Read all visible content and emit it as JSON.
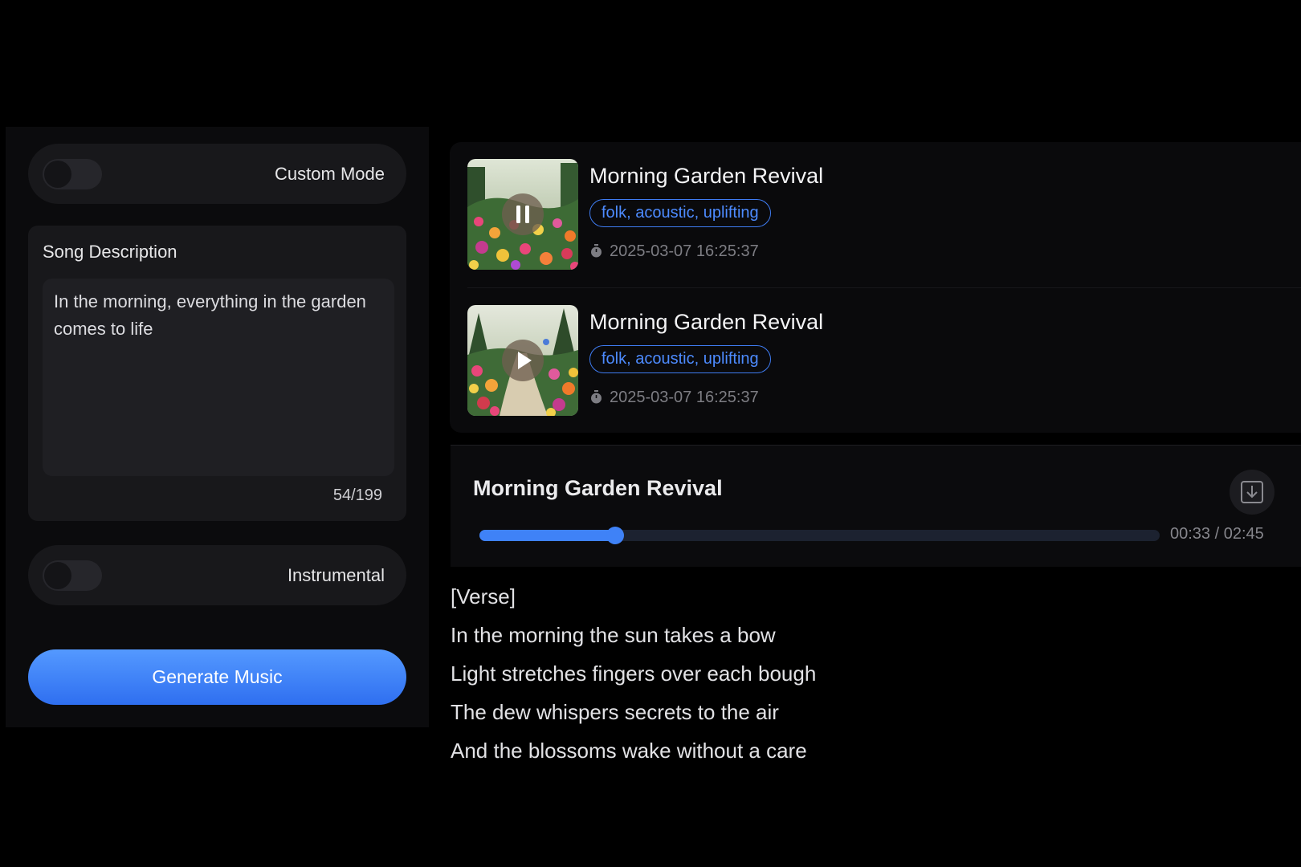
{
  "left_panel": {
    "custom_mode_label": "Custom Mode",
    "song_description": {
      "title": "Song Description",
      "value": "In the morning, everything in the garden comes to life",
      "char_count": "54/199"
    },
    "instrumental_label": "Instrumental",
    "generate_label": "Generate Music"
  },
  "songs": [
    {
      "title": "Morning Garden Revival",
      "tags": "folk, acoustic, uplifting",
      "timestamp": "2025-03-07 16:25:37",
      "state": "playing"
    },
    {
      "title": "Morning Garden Revival",
      "tags": "folk, acoustic, uplifting",
      "timestamp": "2025-03-07 16:25:37",
      "state": "paused"
    }
  ],
  "player": {
    "title": "Morning Garden Revival",
    "current_time": "00:33",
    "separator": " / ",
    "total_time": "02:45",
    "progress_fraction": 0.2,
    "download_icon": "download-icon"
  },
  "lyrics": {
    "lines": [
      "[Verse]",
      "In the morning the sun takes a bow",
      "Light stretches fingers over each bough",
      "The dew whispers secrets to the air",
      "And the blossoms wake without a care"
    ]
  },
  "colors": {
    "accent": "#3f82f7",
    "tag": "#4d8bff",
    "background": "#000000",
    "panel": "#18181b"
  }
}
